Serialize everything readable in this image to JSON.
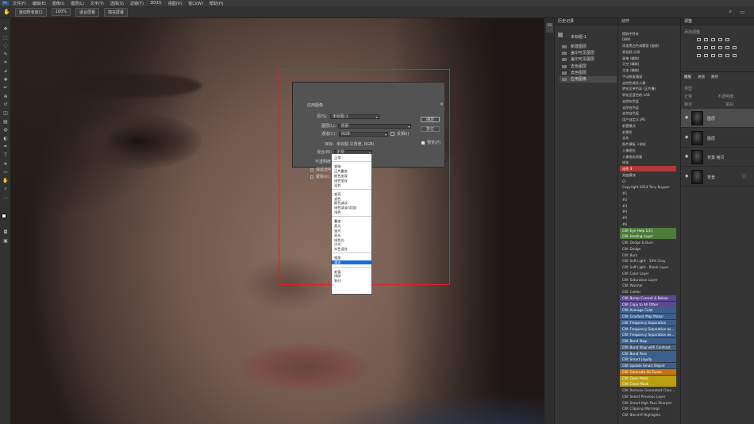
{
  "menubar": {
    "logo": "Ps",
    "items": [
      "文件(F)",
      "编辑(E)",
      "图像(I)",
      "图层(L)",
      "文字(Y)",
      "选择(S)",
      "滤镜(T)",
      "3D(D)",
      "视图(V)",
      "窗口(W)",
      "帮助(H)"
    ]
  },
  "options": {
    "fit_all": "滚动所有窗口",
    "zoom": "100%",
    "fit_screen": "适合屏幕",
    "fill_screen": "填充屏幕"
  },
  "dialog": {
    "title": "应用图像",
    "source_label": "源(S):",
    "source_value": "未标题-1",
    "layer_label": "图层(L):",
    "layer_value": "背景",
    "channel_label": "通道(C):",
    "channel_value": "RGB",
    "invert": "反相(I)",
    "target_label": "目标:",
    "target_value": "未标题-1(背景, RGB)",
    "blending_label": "混合(B):",
    "blending_value": "正常",
    "opacity_partial": "不透明度(O)",
    "preserve_partial": "保留透明",
    "mask_partial": "蒙版(K)...",
    "ok": "确定",
    "reset": "复位",
    "preview": "预览(P)"
  },
  "blend_list": [
    {
      "label": "正常",
      "sep_after": true
    },
    {
      "label": "变暗"
    },
    {
      "label": "正片叠底"
    },
    {
      "label": "颜色加深"
    },
    {
      "label": "线性加深"
    },
    {
      "label": "深色",
      "sep_after": true
    },
    {
      "label": "变亮"
    },
    {
      "label": "滤色"
    },
    {
      "label": "颜色减淡"
    },
    {
      "label": "线性减淡(添加)"
    },
    {
      "label": "浅色",
      "sep_after": true
    },
    {
      "label": "叠加"
    },
    {
      "label": "柔光"
    },
    {
      "label": "强光"
    },
    {
      "label": "亮光"
    },
    {
      "label": "线性光"
    },
    {
      "label": "点光"
    },
    {
      "label": "实色混合",
      "sep_after": true
    },
    {
      "label": "相加"
    },
    {
      "label": "减去",
      "highlight": true,
      "sep_after": true
    },
    {
      "label": "差值"
    },
    {
      "label": "排除"
    },
    {
      "label": "划分"
    }
  ],
  "history": {
    "title": "历史记录",
    "snapshot": "未标题-1",
    "items": [
      "新建图层",
      "盖印可见图层",
      "盖印可见图层",
      "去色图层",
      "去色图层",
      "应用图像"
    ]
  },
  "actions": {
    "title": "动作",
    "items": [
      {
        "label": "提取中性灰"
      },
      {
        "label": "DBW"
      },
      {
        "label": "添加黑白色调蒙版 (曲线)"
      },
      {
        "label": "高低频 分离"
      },
      {
        "label": "画笔 (辅助)"
      },
      {
        "label": "天空 (辅助)"
      },
      {
        "label": "主体 (辅助)"
      },
      {
        "label": "手动修复通道"
      },
      {
        "label": "去除色调及人像"
      },
      {
        "label": "转化至单色彩 (正片叠)"
      },
      {
        "label": "转化至蓝色的 LAB"
      },
      {
        "label": "去除灰色层"
      },
      {
        "label": "去除白色层"
      },
      {
        "label": "去除白色层"
      },
      {
        "label": "用户自定义 JPG"
      },
      {
        "label": "前置模式"
      },
      {
        "label": "前景色"
      },
      {
        "label": "去灰"
      },
      {
        "label": "照片模板 +锐化"
      },
      {
        "label": "人像锐化"
      },
      {
        "label": "人像锐化质量"
      },
      {
        "label": "锐化"
      },
      {
        "label": "动作 3",
        "bg": "#b03a3a"
      },
      {
        "label": "双曲模块"
      },
      {
        "label": "CI"
      },
      {
        "label": "Copyright 2014 Tony Kuyper"
      },
      {
        "label": "#1"
      },
      {
        "label": "#2"
      },
      {
        "label": "#3"
      },
      {
        "label": "#4"
      },
      {
        "label": "#5"
      },
      {
        "label": "#6"
      },
      {
        "label": "CW: Eye Help 1[C]",
        "bg": "#4e7a3a"
      },
      {
        "label": "CW: Healing Layer",
        "bg": "#4e7a3a"
      },
      {
        "label": "CW: Dodge & Burn"
      },
      {
        "label": "CW: Dodge"
      },
      {
        "label": "CW: Burn"
      },
      {
        "label": "CW: Soft Light - 50% Gray"
      },
      {
        "label": "CW: Soft Light - Blank Layer"
      },
      {
        "label": "CW: Color Layer"
      },
      {
        "label": "CW: Saturation Layer"
      },
      {
        "label": "CW: Warmer"
      },
      {
        "label": "CW: Colder"
      },
      {
        "label": "CW: Bump Current & Below",
        "bg": "#5a4a8e"
      },
      {
        "label": "CW: Copy to All Other",
        "bg": "#5a4a8e"
      },
      {
        "label": "CW: Average Color",
        "bg": "#3d5f8c"
      },
      {
        "label": "CW: Gradient Map Maker",
        "bg": "#3d5f8c"
      },
      {
        "label": "CW: Frequency Separation",
        "bg": "#3d5f8c"
      },
      {
        "label": "CW: Frequency Separation wi...",
        "bg": "#3d5f8c"
      },
      {
        "label": "CW: Frequency Separation wi...",
        "bg": "#3d5f8c"
      },
      {
        "label": "CW: Band Stop",
        "bg": "#3d5f8c"
      },
      {
        "label": "CW: Band Stop with Contrast",
        "bg": "#3d5f8c"
      },
      {
        "label": "CW: Band Pass",
        "bg": "#3d5f8c"
      },
      {
        "label": "CW: Smart Liquify",
        "bg": "#3d5f8c"
      },
      {
        "label": "CW: Update Smart Object",
        "bg": "#3d5f8c"
      },
      {
        "label": "CW: Generate All Zones",
        "bg": "#c8740e"
      },
      {
        "label": "CW: Open Mask",
        "bg": "#b8a010"
      },
      {
        "label": "CW: Close Mask",
        "bg": "#b8a010"
      },
      {
        "label": "CW: Remove Generated Chan..."
      },
      {
        "label": "CW: Select Previous Layer"
      },
      {
        "label": "CW: Smart High Pass Sharpen"
      },
      {
        "label": "CW: Clipping Warnings"
      },
      {
        "label": "CW: Blend-If Highlights"
      }
    ]
  },
  "adjustments": {
    "title": "调整",
    "subtitle": "添加调整"
  },
  "layers": {
    "tabs": [
      "图层",
      "通道",
      "路径"
    ],
    "kind": "类型",
    "mode": "正常",
    "opacity": "不透明度:",
    "lock": "锁定:",
    "fill": "填充:",
    "items": [
      "图层",
      "图层",
      "背景 拷贝",
      "背景"
    ]
  }
}
